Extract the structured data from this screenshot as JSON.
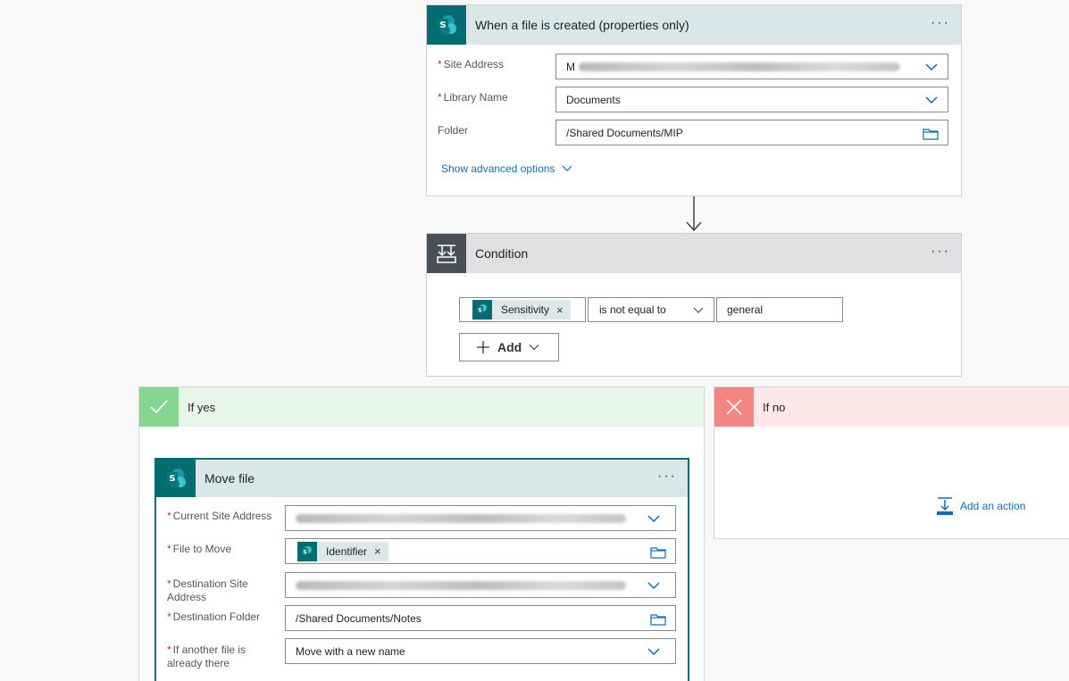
{
  "trigger": {
    "title": "When a file is created (properties only)",
    "fields": {
      "site_address_label": "Site Address",
      "library_name_label": "Library Name",
      "library_name_value": "Documents",
      "folder_label": "Folder",
      "folder_value": "/Shared Documents/MIP"
    },
    "advanced_link": "Show advanced options"
  },
  "condition": {
    "title": "Condition",
    "token": "Sensitivity",
    "operator": "is not equal to",
    "value": "general",
    "add_label": "Add"
  },
  "if_yes": {
    "title": "If yes",
    "action": {
      "title": "Move file",
      "current_site_label": "Current Site Address",
      "file_to_move_label": "File to Move",
      "file_token": "Identifier",
      "dest_site_label_1": "Destination Site",
      "dest_site_label_2": "Address",
      "dest_folder_label": "Destination Folder",
      "dest_folder_value": "/Shared Documents/Notes",
      "conflict_label_1": "If another file is",
      "conflict_label_2": "already there",
      "conflict_value": "Move with a new name"
    }
  },
  "if_no": {
    "title": "If no",
    "add_action": "Add an action"
  },
  "colors": {
    "sharepoint": "#036c70",
    "trigger_header": "#dae7e7",
    "condition_icon": "#484f58",
    "condition_header": "#e0e0e2",
    "yes_icon": "#86d591",
    "yes_header": "#e6f6e8",
    "no_icon": "#f38683",
    "no_header": "#fde7e8",
    "link": "#0f6cbd"
  }
}
